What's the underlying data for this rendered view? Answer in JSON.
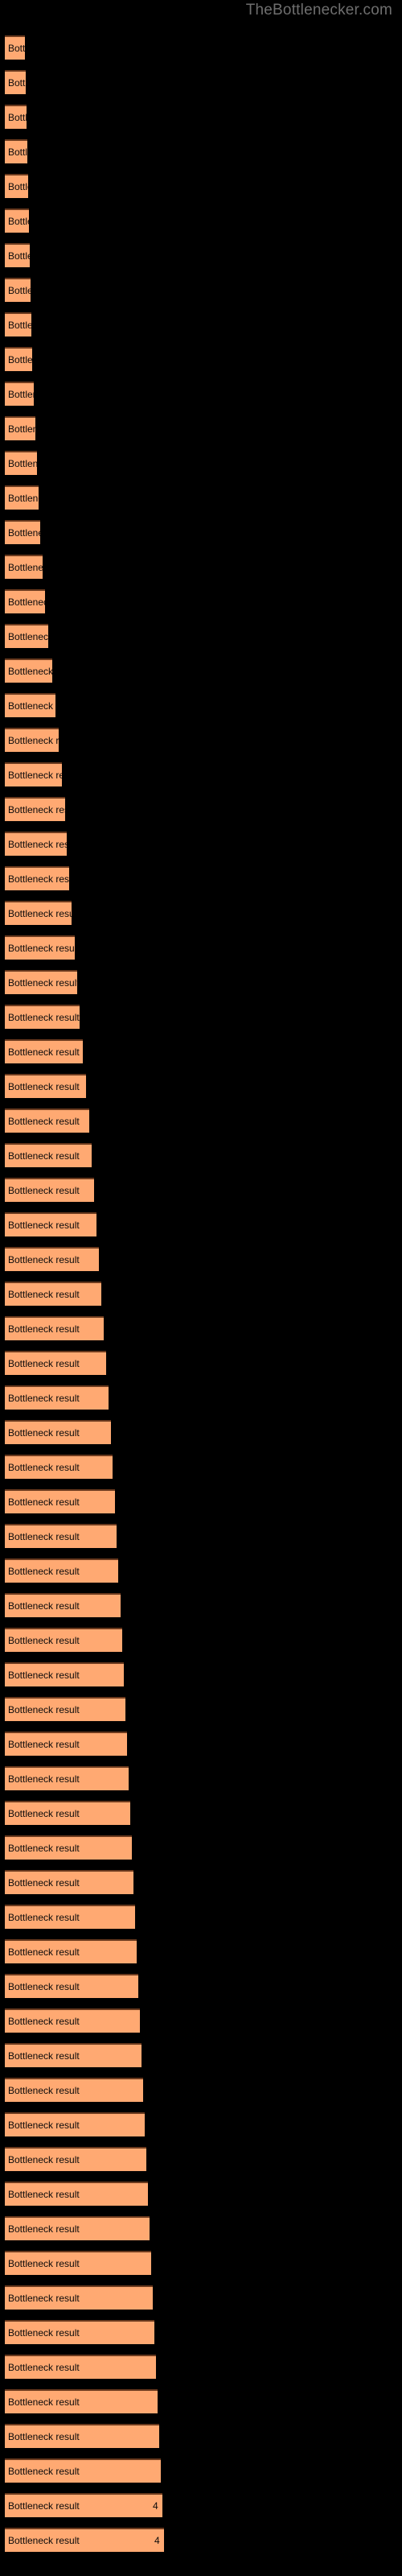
{
  "site": {
    "title": "TheBottlenecker.com",
    "title_color": "#6e6e6e"
  },
  "theme": {
    "background": "#000000",
    "bar_fill": "#ffa972",
    "bar_border_top": "#6b3a1e",
    "bar_text": "#0a0a0a"
  },
  "chart_data": {
    "type": "bar",
    "orientation": "horizontal",
    "title": "",
    "subtitle": "",
    "xlabel": "",
    "ylabel": "",
    "grid": false,
    "legend": null,
    "bar_label_text": "Bottleneck result",
    "xlim": [
      0,
      100
    ],
    "value_unit": "%",
    "note": "Horizontal bar chart of bottleneck result percentages; every bar carries the same label text 'Bottleneck result' clipped by the bar width.",
    "categories": [
      "Bottleneck result",
      "Bottleneck result",
      "Bottleneck result",
      "Bottleneck result",
      "Bottleneck result",
      "Bottleneck result",
      "Bottleneck result",
      "Bottleneck result",
      "Bottleneck result",
      "Bottleneck result",
      "Bottleneck result",
      "Bottleneck result",
      "Bottleneck result",
      "Bottleneck result",
      "Bottleneck result",
      "Bottleneck result",
      "Bottleneck result",
      "Bottleneck result",
      "Bottleneck result",
      "Bottleneck result",
      "Bottleneck result",
      "Bottleneck result",
      "Bottleneck result",
      "Bottleneck result",
      "Bottleneck result",
      "Bottleneck result",
      "Bottleneck result",
      "Bottleneck result",
      "Bottleneck result",
      "Bottleneck result",
      "Bottleneck result",
      "Bottleneck result",
      "Bottleneck result",
      "Bottleneck result",
      "Bottleneck result",
      "Bottleneck result",
      "Bottleneck result",
      "Bottleneck result",
      "Bottleneck result",
      "Bottleneck result",
      "Bottleneck result",
      "Bottleneck result",
      "Bottleneck result",
      "Bottleneck result",
      "Bottleneck result",
      "Bottleneck result",
      "Bottleneck result",
      "Bottleneck result",
      "Bottleneck result",
      "Bottleneck result",
      "Bottleneck result",
      "Bottleneck result",
      "Bottleneck result",
      "Bottleneck result",
      "Bottleneck result",
      "Bottleneck result",
      "Bottleneck result",
      "Bottleneck result",
      "Bottleneck result",
      "Bottleneck result",
      "Bottleneck result",
      "Bottleneck result",
      "Bottleneck result",
      "Bottleneck result",
      "Bottleneck result",
      "Bottleneck result",
      "Bottleneck result",
      "Bottleneck result",
      "Bottleneck result",
      "Bottleneck result",
      "Bottleneck result",
      "Bottleneck result",
      "Bottleneck result"
    ],
    "values": [
      10.5,
      11.0,
      11.5,
      12.0,
      12.5,
      13.0,
      13.5,
      14.0,
      14.5,
      15.0,
      16.0,
      17.0,
      18.0,
      19.0,
      20.0,
      21.5,
      23.0,
      25.0,
      27.5,
      30.0,
      32.0,
      34.0,
      36.0,
      37.0,
      38.0,
      40.0,
      42.0,
      43.5,
      45.0,
      47.0,
      49.0,
      51.0,
      52.5,
      54.0,
      55.5,
      57.0,
      58.5,
      60.0,
      61.5,
      62.5,
      64.0,
      65.0,
      66.5,
      67.5,
      68.5,
      70.0,
      71.0,
      72.0,
      73.0,
      74.0,
      75.0,
      76.0,
      77.0,
      78.0,
      79.0,
      80.0,
      81.0,
      82.0,
      83.0,
      84.0,
      85.0,
      86.0,
      87.0,
      88.0,
      89.0,
      90.0,
      91.0,
      92.0,
      93.0,
      94.0,
      95.0,
      96.0,
      97.0
    ],
    "bar_pixel_widths": [
      25,
      26,
      27,
      28,
      29,
      30,
      31,
      32,
      33,
      34,
      36,
      38,
      40,
      42,
      44,
      47,
      50,
      54,
      59,
      63,
      67,
      71,
      75,
      77,
      80,
      83,
      87,
      90,
      93,
      97,
      101,
      105,
      108,
      111,
      114,
      117,
      120,
      123,
      126,
      129,
      132,
      134,
      137,
      139,
      141,
      144,
      146,
      148,
      150,
      152,
      154,
      156,
      158,
      160,
      162,
      164,
      166,
      168,
      170,
      172,
      174,
      176,
      178,
      180,
      182,
      184,
      186,
      188,
      190,
      192,
      194,
      196,
      198
    ],
    "edge_value_label": "4"
  }
}
